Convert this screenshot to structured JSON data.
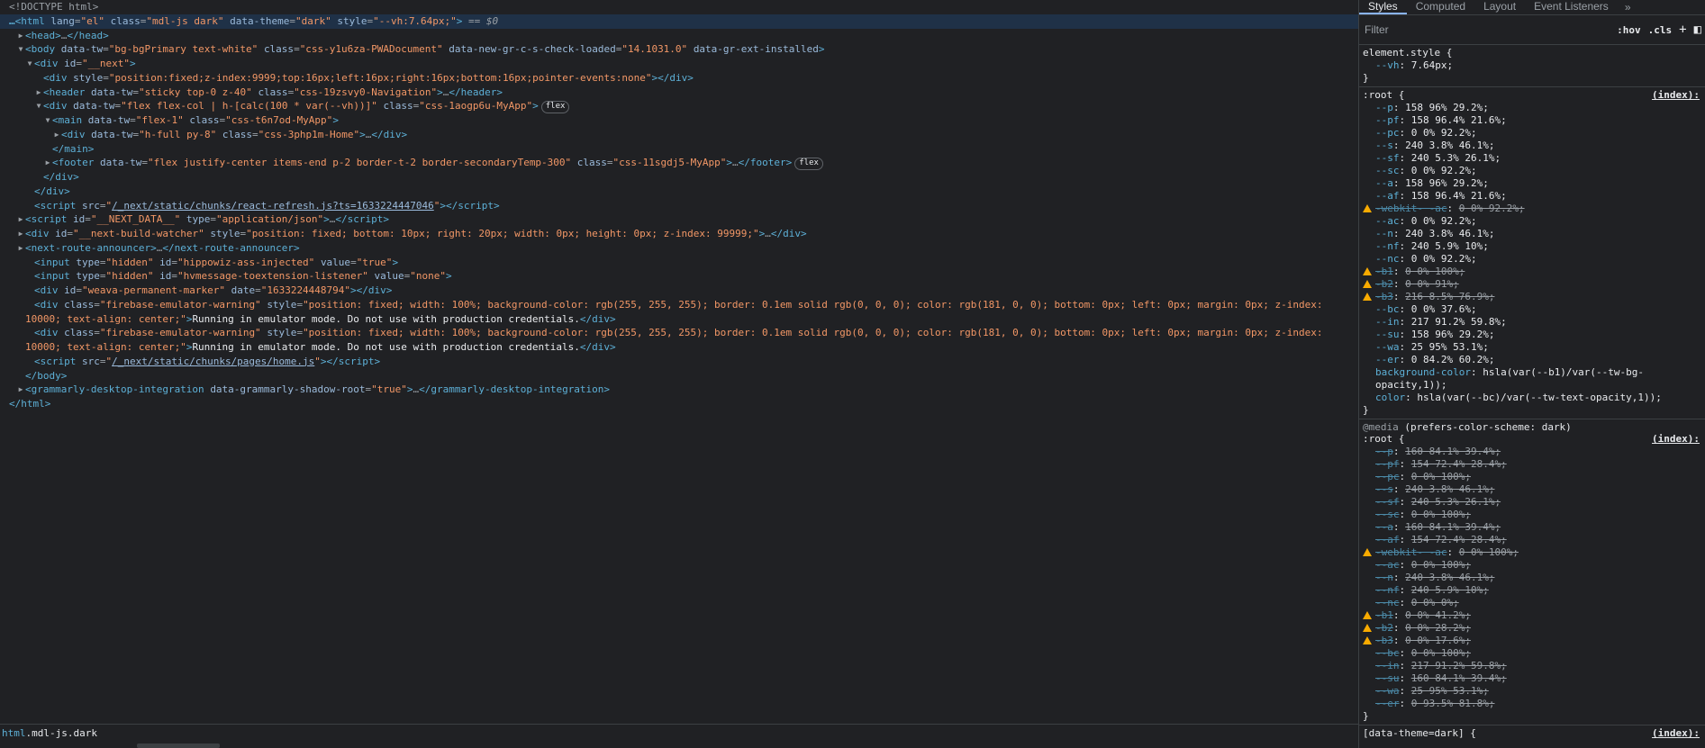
{
  "elements": {
    "lines": [
      {
        "indent": 0,
        "html": "<span class=\"comment\">&lt;!DOCTYPE html&gt;</span>"
      },
      {
        "indent": 0,
        "selected": true,
        "html": "<span class=\"dots\">…</span><span class=\"tag\">&lt;html</span> <span class=\"attr\">lang</span><span class=\"eq\">=</span><span class=\"val\">\"el\"</span> <span class=\"attr\">class</span><span class=\"eq\">=</span><span class=\"val\">\"mdl-js dark\"</span> <span class=\"attr\">data-theme</span><span class=\"eq\">=</span><span class=\"val\">\"dark\"</span> <span class=\"attr\">style</span><span class=\"eq\">=</span><span class=\"val\">\"--vh:7.64px;\"</span><span class=\"tag\">&gt;</span> <span class=\"comment\">==</span> <span class=\"dollar\">$0</span>"
      },
      {
        "indent": 1,
        "tri": "▶",
        "html": "<span class=\"tag\">&lt;head&gt;</span>…<span class=\"tag\">&lt;/head&gt;</span>"
      },
      {
        "indent": 1,
        "tri": "▼",
        "html": "<span class=\"tag\">&lt;body</span> <span class=\"attr\">data-tw</span><span class=\"eq\">=</span><span class=\"val\">\"bg-bgPrimary text-white\"</span> <span class=\"attr\">class</span><span class=\"eq\">=</span><span class=\"val\">\"css-y1u6za-PWADocument\"</span> <span class=\"attr\">data-new-gr-c-s-check-loaded</span><span class=\"eq\">=</span><span class=\"val\">\"14.1031.0\"</span> <span class=\"attr\">data-gr-ext-installed</span><span class=\"tag\">&gt;</span>"
      },
      {
        "indent": 2,
        "tri": "▼",
        "html": "<span class=\"tag\">&lt;div</span> <span class=\"attr\">id</span><span class=\"eq\">=</span><span class=\"val\">\"__next\"</span><span class=\"tag\">&gt;</span>"
      },
      {
        "indent": 3,
        "html": "<span class=\"tag\">&lt;div</span> <span class=\"attr\">style</span><span class=\"eq\">=</span><span class=\"val\">\"position:fixed;z-index:9999;top:16px;left:16px;right:16px;bottom:16px;pointer-events:none\"</span><span class=\"tag\">&gt;&lt;/div&gt;</span>"
      },
      {
        "indent": 3,
        "tri": "▶",
        "html": "<span class=\"tag\">&lt;header</span> <span class=\"attr\">data-tw</span><span class=\"eq\">=</span><span class=\"val\">\"sticky top-0 z-40\"</span> <span class=\"attr\">class</span><span class=\"eq\">=</span><span class=\"val\">\"css-19zsvy0-Navigation\"</span><span class=\"tag\">&gt;</span>…<span class=\"tag\">&lt;/header&gt;</span>"
      },
      {
        "indent": 3,
        "tri": "▼",
        "html": "<span class=\"tag\">&lt;div</span> <span class=\"attr\">data-tw</span><span class=\"eq\">=</span><span class=\"val\">\"flex flex-col | h-[calc(100 * var(--vh))]\"</span> <span class=\"attr\">class</span><span class=\"eq\">=</span><span class=\"val\">\"css-1aogp6u-MyApp\"</span><span class=\"tag\">&gt;</span><span class=\"badge\">flex</span>"
      },
      {
        "indent": 4,
        "tri": "▼",
        "html": "<span class=\"tag\">&lt;main</span> <span class=\"attr\">data-tw</span><span class=\"eq\">=</span><span class=\"val\">\"flex-1\"</span> <span class=\"attr\">class</span><span class=\"eq\">=</span><span class=\"val\">\"css-t6n7od-MyApp\"</span><span class=\"tag\">&gt;</span>"
      },
      {
        "indent": 5,
        "tri": "▶",
        "html": "<span class=\"tag\">&lt;div</span> <span class=\"attr\">data-tw</span><span class=\"eq\">=</span><span class=\"val\">\"h-full py-8\"</span> <span class=\"attr\">class</span><span class=\"eq\">=</span><span class=\"val\">\"css-3php1m-Home\"</span><span class=\"tag\">&gt;</span>…<span class=\"tag\">&lt;/div&gt;</span>"
      },
      {
        "indent": 4,
        "html": "<span class=\"tag\">&lt;/main&gt;</span>"
      },
      {
        "indent": 4,
        "tri": "▶",
        "html": "<span class=\"tag\">&lt;footer</span> <span class=\"attr\">data-tw</span><span class=\"eq\">=</span><span class=\"val\">\"flex justify-center items-end p-2 border-t-2 border-secondaryTemp-300\"</span> <span class=\"attr\">class</span><span class=\"eq\">=</span><span class=\"val\">\"css-11sgdj5-MyApp\"</span><span class=\"tag\">&gt;</span>…<span class=\"tag\">&lt;/footer&gt;</span><span class=\"badge\">flex</span>"
      },
      {
        "indent": 3,
        "html": "<span class=\"tag\">&lt;/div&gt;</span>"
      },
      {
        "indent": 2,
        "html": "<span class=\"tag\">&lt;/div&gt;</span>"
      },
      {
        "indent": 2,
        "html": "<span class=\"tag\">&lt;script</span> <span class=\"attr\">src</span><span class=\"eq\">=</span><span class=\"val\">\"</span><span class=\"url\">/_next/static/chunks/react-refresh.js?ts=1633224447046</span><span class=\"val\">\"</span><span class=\"tag\">&gt;&lt;/script&gt;</span>"
      },
      {
        "indent": 1,
        "tri": "▶",
        "html": "<span class=\"tag\">&lt;script</span> <span class=\"attr\">id</span><span class=\"eq\">=</span><span class=\"val\">\"__NEXT_DATA__\"</span> <span class=\"attr\">type</span><span class=\"eq\">=</span><span class=\"val\">\"application/json\"</span><span class=\"tag\">&gt;</span>…<span class=\"tag\">&lt;/script&gt;</span>"
      },
      {
        "indent": 1,
        "tri": "▶",
        "html": "<span class=\"tag\">&lt;div</span> <span class=\"attr\">id</span><span class=\"eq\">=</span><span class=\"val\">\"__next-build-watcher\"</span> <span class=\"attr\">style</span><span class=\"eq\">=</span><span class=\"val\">\"position: fixed; bottom: 10px; right: 20px; width: 0px; height: 0px; z-index: 99999;\"</span><span class=\"tag\">&gt;</span>…<span class=\"tag\">&lt;/div&gt;</span>"
      },
      {
        "indent": 1,
        "tri": "▶",
        "html": "<span class=\"tag\">&lt;next-route-announcer&gt;</span>…<span class=\"tag\">&lt;/next-route-announcer&gt;</span>"
      },
      {
        "indent": 2,
        "html": "<span class=\"tag\">&lt;input</span> <span class=\"attr\">type</span><span class=\"eq\">=</span><span class=\"val\">\"hidden\"</span> <span class=\"attr\">id</span><span class=\"eq\">=</span><span class=\"val\">\"hippowiz-ass-injected\"</span> <span class=\"attr\">value</span><span class=\"eq\">=</span><span class=\"val\">\"true\"</span><span class=\"tag\">&gt;</span>"
      },
      {
        "indent": 2,
        "html": "<span class=\"tag\">&lt;input</span> <span class=\"attr\">type</span><span class=\"eq\">=</span><span class=\"val\">\"hidden\"</span> <span class=\"attr\">id</span><span class=\"eq\">=</span><span class=\"val\">\"hvmessage-toextension-listener\"</span> <span class=\"attr\">value</span><span class=\"eq\">=</span><span class=\"val\">\"none\"</span><span class=\"tag\">&gt;</span>"
      },
      {
        "indent": 2,
        "html": "<span class=\"tag\">&lt;div</span> <span class=\"attr\">id</span><span class=\"eq\">=</span><span class=\"val\">\"weava-permanent-marker\"</span> <span class=\"attr\">date</span><span class=\"eq\">=</span><span class=\"val\">\"1633224448794\"</span><span class=\"tag\">&gt;&lt;/div&gt;</span>"
      },
      {
        "indent": 2,
        "wrap": true,
        "html": "<span class=\"tag\">&lt;div</span> <span class=\"attr\">class</span><span class=\"eq\">=</span><span class=\"val\">\"firebase-emulator-warning\"</span> <span class=\"attr\">style</span><span class=\"eq\">=</span><span class=\"val\">\"position: fixed; width: 100%; background-color: rgb(255, 255, 255); border: 0.1em solid rgb(0, 0, 0); color: rgb(181, 0, 0); bottom: 0px; left: 0px; margin: 0px; z-index: 10000; text-align: center;\"</span><span class=\"tag\">&gt;</span><span class=\"text\">Running in emulator mode. Do not use with production credentials.</span><span class=\"tag\">&lt;/div&gt;</span>"
      },
      {
        "indent": 2,
        "wrap": true,
        "html": "<span class=\"tag\">&lt;div</span> <span class=\"attr\">class</span><span class=\"eq\">=</span><span class=\"val\">\"firebase-emulator-warning\"</span> <span class=\"attr\">style</span><span class=\"eq\">=</span><span class=\"val\">\"position: fixed; width: 100%; background-color: rgb(255, 255, 255); border: 0.1em solid rgb(0, 0, 0); color: rgb(181, 0, 0); bottom: 0px; left: 0px; margin: 0px; z-index: 10000; text-align: center;\"</span><span class=\"tag\">&gt;</span><span class=\"text\">Running in emulator mode. Do not use with production credentials.</span><span class=\"tag\">&lt;/div&gt;</span>"
      },
      {
        "indent": 2,
        "html": "<span class=\"tag\">&lt;script</span> <span class=\"attr\">src</span><span class=\"eq\">=</span><span class=\"val\">\"</span><span class=\"url\">/_next/static/chunks/pages/home.js</span><span class=\"val\">\"</span><span class=\"tag\">&gt;&lt;/script&gt;</span>"
      },
      {
        "indent": 1,
        "html": "<span class=\"tag\">&lt;/body&gt;</span>"
      },
      {
        "indent": 1,
        "tri": "▶",
        "html": "<span class=\"tag\">&lt;grammarly-desktop-integration</span> <span class=\"attr\">data-grammarly-shadow-root</span><span class=\"eq\">=</span><span class=\"val\">\"true\"</span><span class=\"tag\">&gt;</span>…<span class=\"tag\">&lt;/grammarly-desktop-integration&gt;</span>"
      },
      {
        "indent": 0,
        "html": "<span class=\"tag\">&lt;/html&gt;</span>"
      }
    ]
  },
  "breadcrumb": {
    "tag": "html",
    "classes": ".mdl-js.dark"
  },
  "styles": {
    "tabs": [
      "Styles",
      "Computed",
      "Layout",
      "Event Listeners"
    ],
    "more_label": "»",
    "filter_placeholder": "Filter",
    "hov_label": ":hov",
    "cls_label": ".cls",
    "plus_label": "+",
    "toggle_label": "◧",
    "element_style": {
      "selector": "element.style {",
      "decls": [
        {
          "name": "--vh",
          "value": "7.64px;"
        }
      ],
      "close": "}"
    },
    "root": {
      "selector": ":root {",
      "source": "(index):",
      "decls": [
        {
          "name": "--p",
          "value": "158 96% 29.2%;"
        },
        {
          "name": "--pf",
          "value": "158 96.4% 21.6%;"
        },
        {
          "name": "--pc",
          "value": "0 0% 92.2%;"
        },
        {
          "name": "--s",
          "value": "240 3.8% 46.1%;"
        },
        {
          "name": "--sf",
          "value": "240 5.3% 26.1%;"
        },
        {
          "name": "--sc",
          "value": "0 0% 92.2%;"
        },
        {
          "name": "--a",
          "value": "158 96% 29.2%;"
        },
        {
          "name": "--af",
          "value": "158 96.4% 21.6%;"
        },
        {
          "name": "-webkit- -ac",
          "value": "0 0% 92.2%;",
          "over": true,
          "warn": true
        },
        {
          "name": "--ac",
          "value": "0 0% 92.2%;"
        },
        {
          "name": "--n",
          "value": "240 3.8% 46.1%;"
        },
        {
          "name": "--nf",
          "value": "240 5.9% 10%;"
        },
        {
          "name": "--nc",
          "value": "0 0% 92.2%;"
        },
        {
          "name": "-b1",
          "value": "0 0% 100%;",
          "over": true,
          "warn": true
        },
        {
          "name": "-b2",
          "value": "0 0% 91%;",
          "over": true,
          "warn": true
        },
        {
          "name": "-b3",
          "value": "216 8.5% 76.9%;",
          "over": true,
          "warn": true
        },
        {
          "name": "--bc",
          "value": "0 0% 37.6%;"
        },
        {
          "name": "--in",
          "value": "217 91.2% 59.8%;"
        },
        {
          "name": "--su",
          "value": "158 96% 29.2%;"
        },
        {
          "name": "--wa",
          "value": "25 95% 53.1%;"
        },
        {
          "name": "--er",
          "value": "0 84.2% 60.2%;"
        },
        {
          "name": "background-color",
          "value": "hsla(var(--b1)/var(--tw-bg-opacity,1));",
          "wrap": true
        },
        {
          "name": "color",
          "value": "hsla(var(--bc)/var(--tw-text-opacity,1));"
        }
      ],
      "close": "}"
    },
    "media_root": {
      "media_at": "@media",
      "media_query": "(prefers-color-scheme: dark)",
      "selector": ":root {",
      "source": "(index):",
      "decls": [
        {
          "name": "--p",
          "value": "160 84.1% 39.4%;",
          "over": true
        },
        {
          "name": "--pf",
          "value": "154 72.4% 28.4%;",
          "over": true
        },
        {
          "name": "--pc",
          "value": "0 0% 100%;",
          "over": true
        },
        {
          "name": "--s",
          "value": "240 3.8% 46.1%;",
          "over": true
        },
        {
          "name": "--sf",
          "value": "240 5.3% 26.1%;",
          "over": true
        },
        {
          "name": "--sc",
          "value": "0 0% 100%;",
          "over": true
        },
        {
          "name": "--a",
          "value": "160 84.1% 39.4%;",
          "over": true
        },
        {
          "name": "--af",
          "value": "154 72.4% 28.4%;",
          "over": true
        },
        {
          "name": "-webkit- -ac",
          "value": "0 0% 100%;",
          "over": true,
          "warn": true
        },
        {
          "name": "--ac",
          "value": "0 0% 100%;",
          "over": true
        },
        {
          "name": "--n",
          "value": "240 3.8% 46.1%;",
          "over": true
        },
        {
          "name": "--nf",
          "value": "240 5.9% 10%;",
          "over": true
        },
        {
          "name": "--nc",
          "value": "0 0% 0%;",
          "over": true
        },
        {
          "name": "-b1",
          "value": "0 0% 41.2%;",
          "over": true,
          "warn": true
        },
        {
          "name": "-b2",
          "value": "0 0% 28.2%;",
          "over": true,
          "warn": true
        },
        {
          "name": "-b3",
          "value": "0 0% 17.6%;",
          "over": true,
          "warn": true
        },
        {
          "name": "--bc",
          "value": "0 0% 100%;",
          "over": true
        },
        {
          "name": "--in",
          "value": "217 91.2% 59.8%;",
          "over": true
        },
        {
          "name": "--su",
          "value": "160 84.1% 39.4%;",
          "over": true
        },
        {
          "name": "--wa",
          "value": "25 95% 53.1%;",
          "over": true
        },
        {
          "name": "--er",
          "value": "0 93.5% 81.8%;",
          "over": true
        }
      ],
      "close": "}"
    },
    "theme_rule": {
      "selector": "[data-theme=dark] {",
      "source": "(index):"
    }
  },
  "colors": {
    "accent": "#8ab4f8",
    "tag": "#5db0d7",
    "attr_value": "#f29766",
    "warning": "#f9ab00",
    "selected_row": "#1f3147"
  }
}
